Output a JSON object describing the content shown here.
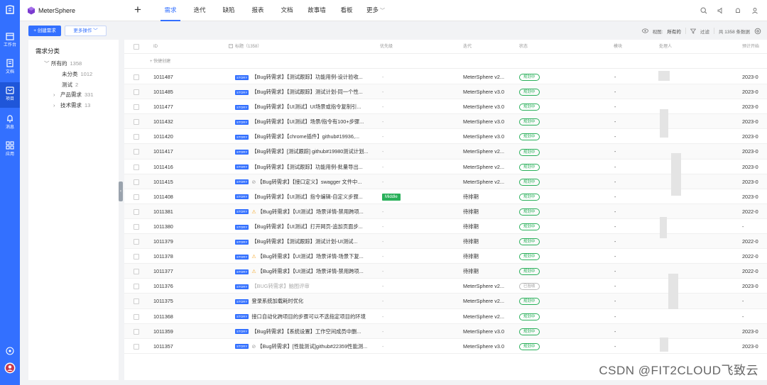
{
  "app": {
    "name": "MeterSphere"
  },
  "rail": {
    "items": [
      {
        "label": "工作台",
        "icon": "workbench-icon"
      },
      {
        "label": "文档",
        "icon": "document-icon"
      },
      {
        "label": "项目",
        "icon": "project-icon"
      },
      {
        "label": "消息",
        "icon": "bell-icon"
      },
      {
        "label": "应用",
        "icon": "apps-icon"
      }
    ],
    "active_index": 2
  },
  "nav": {
    "items": [
      "需求",
      "迭代",
      "缺陷",
      "报表",
      "文档",
      "故事墙",
      "看板",
      "更多"
    ],
    "active_index": 0
  },
  "toolbar": {
    "create_label": "+ 创建需求",
    "more_label": "更多操作 ﹀",
    "view_label": "视图:",
    "view_value": "所有的",
    "filter_label": "过滤",
    "total_label": "共 1358 条数据"
  },
  "categories": {
    "title": "需求分类",
    "items": [
      {
        "label": "所有的",
        "count": "1358",
        "caret": "﹀"
      },
      {
        "label": "未分类",
        "count": "1012",
        "caret": ""
      },
      {
        "label": "测试",
        "count": "2",
        "caret": ""
      },
      {
        "label": "产品需求",
        "count": "331",
        "caret": "›"
      },
      {
        "label": "技术需求",
        "count": "13",
        "caret": "›"
      }
    ]
  },
  "table": {
    "columns": {
      "id": "ID",
      "title": "标题（1358）",
      "priority": "优先级",
      "iteration": "迭代",
      "status": "状态",
      "module": "模块",
      "handler": "处理人",
      "deadline": "预计开始"
    },
    "quick_create": "+ 快捷创建",
    "rows": [
      {
        "id": "1011487",
        "tag": "STORY",
        "mark": "",
        "title": "【Bug转需求】【测试跟踪】功能用例-设计验收...",
        "priority": "-",
        "iteration": "MeterSphere v2...",
        "status": "规划中",
        "module": "-",
        "date": "2023-0"
      },
      {
        "id": "1011485",
        "tag": "STORY",
        "mark": "",
        "title": "【Bug转需求】【测试跟踪】测试计划-同一个性...",
        "priority": "-",
        "iteration": "MeterSphere v3.0",
        "status": "规划中",
        "module": "-",
        "date": "2023-0"
      },
      {
        "id": "1011477",
        "tag": "STORY",
        "mark": "",
        "title": "【Bug转需求】【UI测试】UI场景或指令复制引...",
        "priority": "-",
        "iteration": "MeterSphere v3.0",
        "status": "规划中",
        "module": "-",
        "date": "2023-0"
      },
      {
        "id": "1011432",
        "tag": "STORY",
        "mark": "",
        "title": "【Bug转需求】【UI测试】场景/指令有100+步骤...",
        "priority": "-",
        "iteration": "MeterSphere v3.0",
        "status": "规划中",
        "module": "-",
        "date": "2023-0"
      },
      {
        "id": "1011420",
        "tag": "STORY",
        "mark": "",
        "title": "【Bug转需求】【chrome插件】github#19936,...",
        "priority": "-",
        "iteration": "MeterSphere v3.0",
        "status": "规划中",
        "module": "-",
        "date": "2023-0"
      },
      {
        "id": "1011417",
        "tag": "STORY",
        "mark": "",
        "title": "【Bug转需求】[测试跟踪] github#19980测试计划...",
        "priority": "-",
        "iteration": "MeterSphere v2...",
        "status": "规划中",
        "module": "-",
        "date": "2023-0"
      },
      {
        "id": "1011416",
        "tag": "STORY",
        "mark": "",
        "title": "【Bug转需求】【测试跟踪】功能用例-批量导出...",
        "priority": "-",
        "iteration": "MeterSphere v2...",
        "status": "规划中",
        "module": "-",
        "date": "2023-0"
      },
      {
        "id": "1011415",
        "tag": "STORY",
        "mark": "flag",
        "title": "【Bug转需求】【接口定义】swagger 文件中...",
        "priority": "-",
        "iteration": "MeterSphere v2...",
        "status": "规划中",
        "module": "-",
        "date": "2023-0"
      },
      {
        "id": "1011408",
        "tag": "STORY",
        "mark": "",
        "title": "【Bug转需求】【UI测试】指令编辑-自定义步骤...",
        "priority": "Middle",
        "iteration": "待排期",
        "status": "规划中",
        "module": "-",
        "date": "2023-0"
      },
      {
        "id": "1011381",
        "tag": "STORY",
        "mark": "warn",
        "title": "【Bug转需求】【UI测试】场景详情-禁用跨项...",
        "priority": "-",
        "iteration": "待排期",
        "status": "规划中",
        "module": "-",
        "date": "2022-0"
      },
      {
        "id": "1011380",
        "tag": "STORY",
        "mark": "",
        "title": "【Bug转需求】【UI测试】打开网页-追加页面步...",
        "priority": "-",
        "iteration": "待排期",
        "status": "规划中",
        "module": "-",
        "date": "-"
      },
      {
        "id": "1011379",
        "tag": "STORY",
        "mark": "",
        "title": "【Bug转需求】【测试跟踪】测试计划-UI测试...",
        "priority": "-",
        "iteration": "待排期",
        "status": "规划中",
        "module": "-",
        "date": "2022-0"
      },
      {
        "id": "1011378",
        "tag": "STORY",
        "mark": "warn",
        "title": "【Bug转需求】【UI测试】场景详情-场景下复...",
        "priority": "-",
        "iteration": "待排期",
        "status": "规划中",
        "module": "-",
        "date": "2022-0"
      },
      {
        "id": "1011377",
        "tag": "STORY",
        "mark": "warn",
        "title": "【Bug转需求】【UI测试】场景详情-禁用跨项...",
        "priority": "-",
        "iteration": "待排期",
        "status": "规划中",
        "module": "-",
        "date": "2022-0"
      },
      {
        "id": "1011376",
        "tag": "STORY",
        "mark": "",
        "title": "【BUG转需求】脑图评审",
        "priority": "-",
        "iteration": "MeterSphere v2...",
        "status": "已验收",
        "module": "-",
        "date": "2023-0",
        "muted": true
      },
      {
        "id": "1011375",
        "tag": "STORY",
        "mark": "",
        "title": "登录系统加载耗时优化",
        "priority": "-",
        "iteration": "MeterSphere v2...",
        "status": "规划中",
        "module": "-",
        "date": "-"
      },
      {
        "id": "1011368",
        "tag": "STORY",
        "mark": "",
        "title": "接口自动化跨项目的步骤可以不选指定项目的环境",
        "priority": "-",
        "iteration": "MeterSphere v2...",
        "status": "规划中",
        "module": "-",
        "date": "-"
      },
      {
        "id": "1011359",
        "tag": "STORY",
        "mark": "",
        "title": "【Bug转需求】【系统设置】工作空间成员中删...",
        "priority": "-",
        "iteration": "MeterSphere v3.0",
        "status": "规划中",
        "module": "-",
        "date": "2023-0"
      },
      {
        "id": "1011357",
        "tag": "STORY",
        "mark": "flag",
        "title": "【Bug转需求】[性能测试]github#22359性能测...",
        "priority": "-",
        "iteration": "MeterSphere v3.0",
        "status": "规划中",
        "module": "-",
        "date": "2023-0"
      }
    ]
  },
  "watermark": "CSDN @FIT2CLOUD飞致云"
}
